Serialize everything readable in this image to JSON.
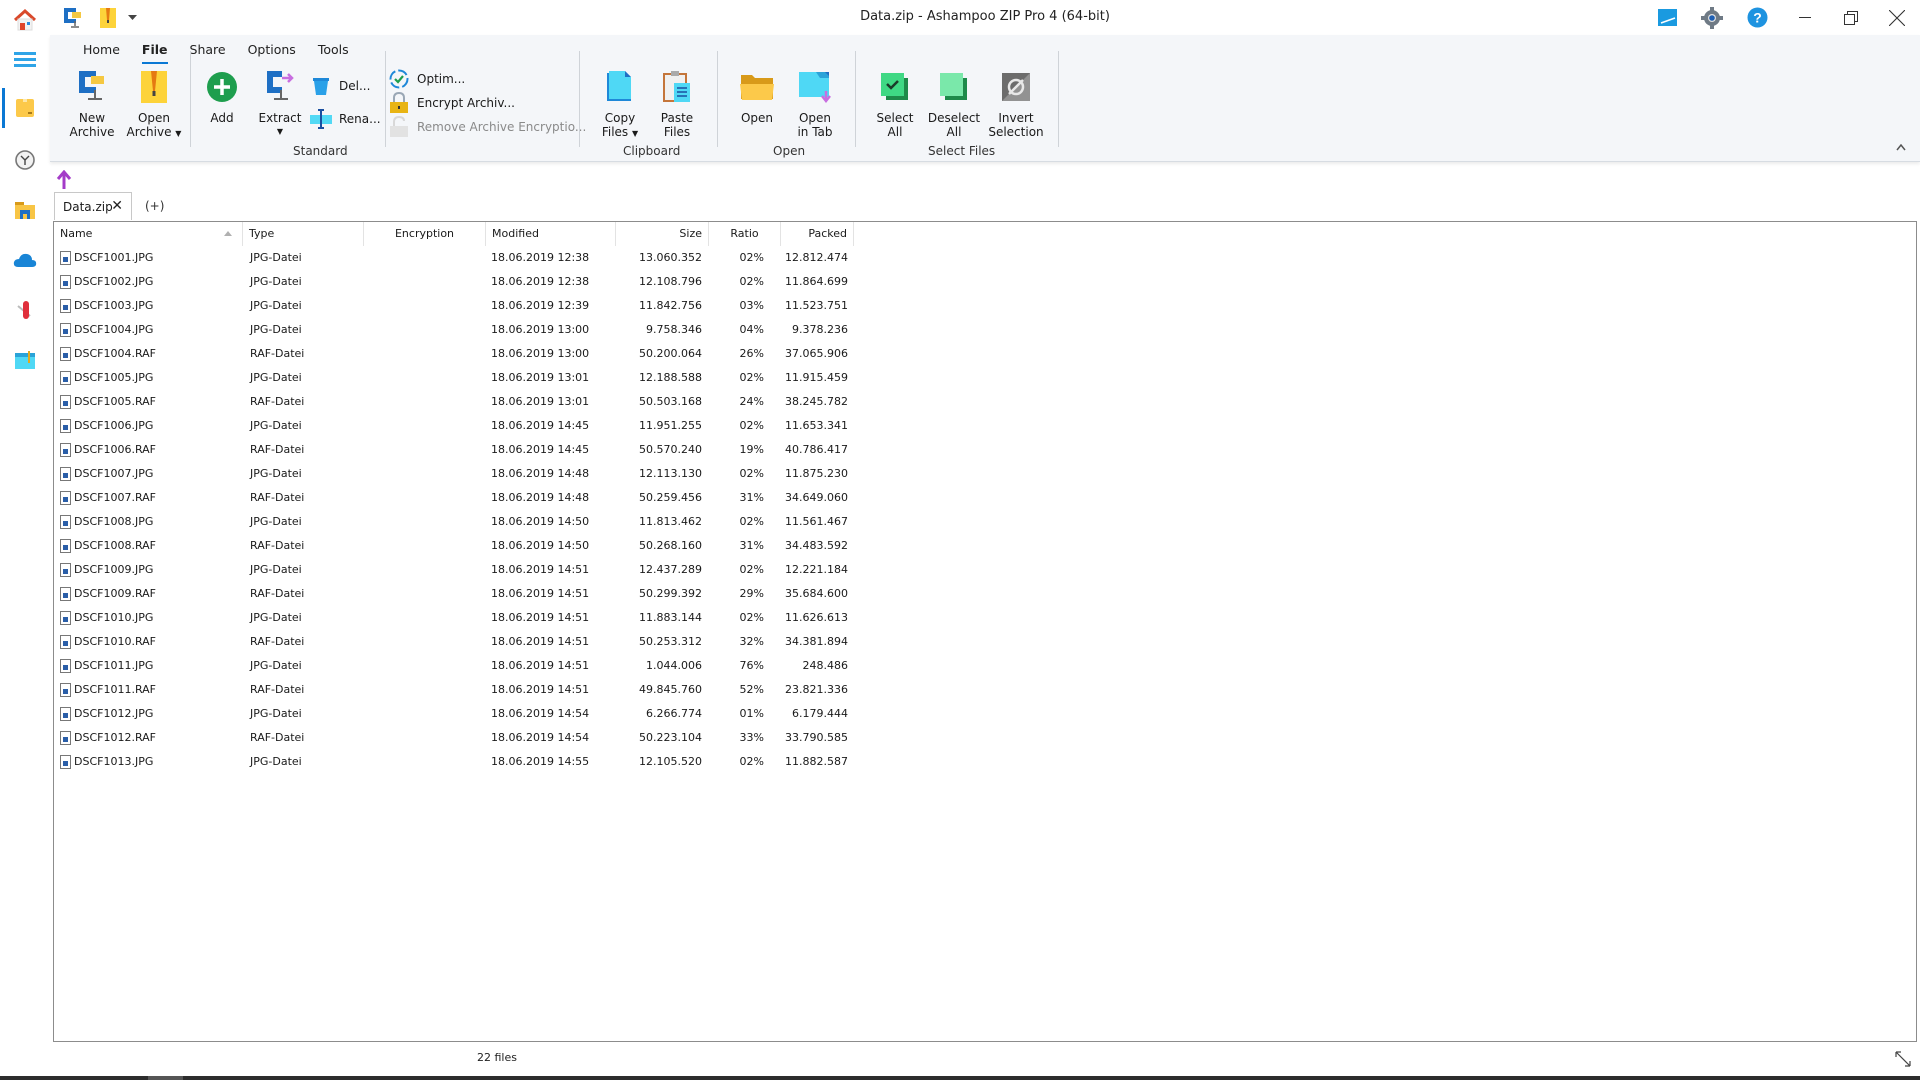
{
  "window": {
    "title": "Data.zip - Ashampoo ZIP Pro 4 (64-bit)"
  },
  "sidebar": {
    "items": [
      {
        "name": "home",
        "icon": "home-icon"
      },
      {
        "name": "menu",
        "icon": "hamburger-menu-icon"
      },
      {
        "name": "archive",
        "icon": "package-icon",
        "active": true
      },
      {
        "name": "recent",
        "icon": "clock-icon"
      },
      {
        "name": "explorer",
        "icon": "folder-icon"
      },
      {
        "name": "cloud",
        "icon": "cloud-icon"
      },
      {
        "name": "tools",
        "icon": "swiss-knife-icon"
      },
      {
        "name": "screen",
        "icon": "window-icon"
      }
    ]
  },
  "quick_access": {
    "new_archive_icon": "clamp-icon",
    "open_archive_icon": "zip-file-icon",
    "dropdown_icon": "chevron-down-icon"
  },
  "title_icons": [
    "pen-tablet-icon",
    "gear-icon",
    "help-icon"
  ],
  "ribbon": {
    "tabs": [
      "Home",
      "File",
      "Share",
      "Options",
      "Tools"
    ],
    "active_tab": "File",
    "groups": {
      "standard": {
        "label": "Standard",
        "new_archive": "New\nArchive",
        "new_archive_l1": "New",
        "new_archive_l2": "Archive",
        "open_archive_l1": "Open",
        "open_archive_l2": "Archive",
        "add": "Add",
        "extract": "Extract",
        "delete": "Del...",
        "rename": "Rena...",
        "optimize": "Optim...",
        "encrypt": "Encrypt Archiv...",
        "remove_encryption": "Remove Archive Encryptio..."
      },
      "clipboard": {
        "label": "Clipboard",
        "copy_l1": "Copy",
        "copy_l2": "Files",
        "paste_l1": "Paste",
        "paste_l2": "Files"
      },
      "open": {
        "label": "Open",
        "open": "Open",
        "open_tab_l1": "Open",
        "open_tab_l2": "in Tab"
      },
      "select": {
        "label": "Select Files",
        "select_all_l1": "Select",
        "select_all_l2": "All",
        "deselect_all_l1": "Deselect",
        "deselect_all_l2": "All",
        "invert_l1": "Invert",
        "invert_l2": "Selection"
      }
    }
  },
  "doc_tabs": {
    "tabs": [
      "Data.zip"
    ],
    "add_label": "(+)"
  },
  "table": {
    "columns": [
      "Name",
      "Type",
      "Encryption",
      "Modified",
      "Size",
      "Ratio",
      "Packed"
    ],
    "sort_column": "Name",
    "rows": [
      {
        "name": "DSCF1001.JPG",
        "type": "JPG-Datei",
        "encryption": "",
        "modified": "18.06.2019 12:38",
        "size": "13.060.352",
        "ratio": "02%",
        "packed": "12.812.474"
      },
      {
        "name": "DSCF1002.JPG",
        "type": "JPG-Datei",
        "encryption": "",
        "modified": "18.06.2019 12:38",
        "size": "12.108.796",
        "ratio": "02%",
        "packed": "11.864.699"
      },
      {
        "name": "DSCF1003.JPG",
        "type": "JPG-Datei",
        "encryption": "",
        "modified": "18.06.2019 12:39",
        "size": "11.842.756",
        "ratio": "03%",
        "packed": "11.523.751"
      },
      {
        "name": "DSCF1004.JPG",
        "type": "JPG-Datei",
        "encryption": "",
        "modified": "18.06.2019 13:00",
        "size": "9.758.346",
        "ratio": "04%",
        "packed": "9.378.236"
      },
      {
        "name": "DSCF1004.RAF",
        "type": "RAF-Datei",
        "encryption": "",
        "modified": "18.06.2019 13:00",
        "size": "50.200.064",
        "ratio": "26%",
        "packed": "37.065.906"
      },
      {
        "name": "DSCF1005.JPG",
        "type": "JPG-Datei",
        "encryption": "",
        "modified": "18.06.2019 13:01",
        "size": "12.188.588",
        "ratio": "02%",
        "packed": "11.915.459"
      },
      {
        "name": "DSCF1005.RAF",
        "type": "RAF-Datei",
        "encryption": "",
        "modified": "18.06.2019 13:01",
        "size": "50.503.168",
        "ratio": "24%",
        "packed": "38.245.782"
      },
      {
        "name": "DSCF1006.JPG",
        "type": "JPG-Datei",
        "encryption": "",
        "modified": "18.06.2019 14:45",
        "size": "11.951.255",
        "ratio": "02%",
        "packed": "11.653.341"
      },
      {
        "name": "DSCF1006.RAF",
        "type": "RAF-Datei",
        "encryption": "",
        "modified": "18.06.2019 14:45",
        "size": "50.570.240",
        "ratio": "19%",
        "packed": "40.786.417"
      },
      {
        "name": "DSCF1007.JPG",
        "type": "JPG-Datei",
        "encryption": "",
        "modified": "18.06.2019 14:48",
        "size": "12.113.130",
        "ratio": "02%",
        "packed": "11.875.230"
      },
      {
        "name": "DSCF1007.RAF",
        "type": "RAF-Datei",
        "encryption": "",
        "modified": "18.06.2019 14:48",
        "size": "50.259.456",
        "ratio": "31%",
        "packed": "34.649.060"
      },
      {
        "name": "DSCF1008.JPG",
        "type": "JPG-Datei",
        "encryption": "",
        "modified": "18.06.2019 14:50",
        "size": "11.813.462",
        "ratio": "02%",
        "packed": "11.561.467"
      },
      {
        "name": "DSCF1008.RAF",
        "type": "RAF-Datei",
        "encryption": "",
        "modified": "18.06.2019 14:50",
        "size": "50.268.160",
        "ratio": "31%",
        "packed": "34.483.592"
      },
      {
        "name": "DSCF1009.JPG",
        "type": "JPG-Datei",
        "encryption": "",
        "modified": "18.06.2019 14:51",
        "size": "12.437.289",
        "ratio": "02%",
        "packed": "12.221.184"
      },
      {
        "name": "DSCF1009.RAF",
        "type": "RAF-Datei",
        "encryption": "",
        "modified": "18.06.2019 14:51",
        "size": "50.299.392",
        "ratio": "29%",
        "packed": "35.684.600"
      },
      {
        "name": "DSCF1010.JPG",
        "type": "JPG-Datei",
        "encryption": "",
        "modified": "18.06.2019 14:51",
        "size": "11.883.144",
        "ratio": "02%",
        "packed": "11.626.613"
      },
      {
        "name": "DSCF1010.RAF",
        "type": "RAF-Datei",
        "encryption": "",
        "modified": "18.06.2019 14:51",
        "size": "50.253.312",
        "ratio": "32%",
        "packed": "34.381.894"
      },
      {
        "name": "DSCF1011.JPG",
        "type": "JPG-Datei",
        "encryption": "",
        "modified": "18.06.2019 14:51",
        "size": "1.044.006",
        "ratio": "76%",
        "packed": "248.486"
      },
      {
        "name": "DSCF1011.RAF",
        "type": "RAF-Datei",
        "encryption": "",
        "modified": "18.06.2019 14:51",
        "size": "49.845.760",
        "ratio": "52%",
        "packed": "23.821.336"
      },
      {
        "name": "DSCF1012.JPG",
        "type": "JPG-Datei",
        "encryption": "",
        "modified": "18.06.2019 14:54",
        "size": "6.266.774",
        "ratio": "01%",
        "packed": "6.179.444"
      },
      {
        "name": "DSCF1012.RAF",
        "type": "RAF-Datei",
        "encryption": "",
        "modified": "18.06.2019 14:54",
        "size": "50.223.104",
        "ratio": "33%",
        "packed": "33.790.585"
      },
      {
        "name": "DSCF1013.JPG",
        "type": "JPG-Datei",
        "encryption": "",
        "modified": "18.06.2019 14:55",
        "size": "12.105.520",
        "ratio": "02%",
        "packed": "11.882.587"
      }
    ]
  },
  "status": {
    "file_count": "22 files"
  },
  "colors": {
    "accent": "#0a78d4",
    "ribbon_bg": "#f4f6f9",
    "add_green": "#1e9e4e",
    "select_green": "#2fbf71"
  }
}
